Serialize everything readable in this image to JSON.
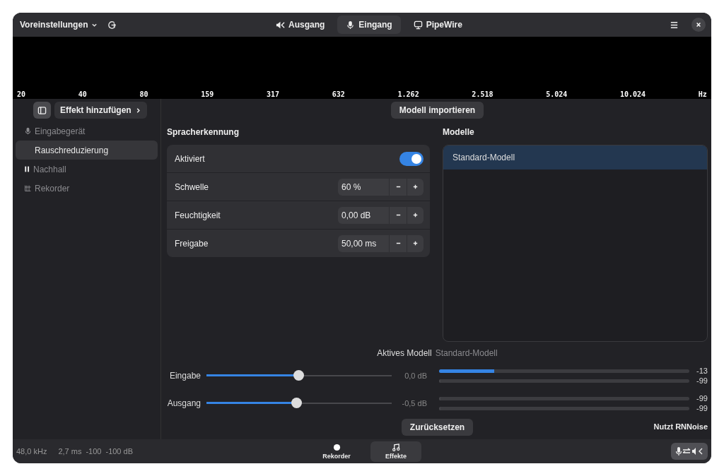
{
  "header": {
    "presets": {
      "label": "Voreinstellungen"
    },
    "tabs": [
      {
        "label": "Ausgang",
        "kind": "output",
        "selected": false
      },
      {
        "label": "Eingang",
        "kind": "input",
        "selected": true
      },
      {
        "label": "PipeWire",
        "kind": "pipewire",
        "selected": false
      }
    ]
  },
  "spectrum": {
    "labels": [
      "20",
      "40",
      "80",
      "159",
      "317",
      "632",
      "1.262",
      "2.518",
      "5.024",
      "10.024",
      "Hz"
    ]
  },
  "sidebar": {
    "add_button": "Effekt hinzufügen",
    "items": [
      {
        "label": "Eingabegerät",
        "kind": "device",
        "selected": false
      },
      {
        "label": "Rauschreduzierung",
        "kind": "plugin",
        "selected": true
      },
      {
        "label": "Nachhall",
        "kind": "paused",
        "selected": false
      },
      {
        "label": "Rekorder",
        "kind": "recorder",
        "selected": false
      }
    ]
  },
  "main": {
    "import_button": "Modell importieren",
    "voice": {
      "title": "Spracherkennung",
      "rows": [
        {
          "label": "Aktiviert",
          "kind": "switch",
          "on": true
        },
        {
          "label": "Schwelle",
          "kind": "spin",
          "value": "60 %"
        },
        {
          "label": "Feuchtigkeit",
          "kind": "spin",
          "value": "0,00 dB"
        },
        {
          "label": "Freigabe",
          "kind": "spin",
          "value": "50,00 ms"
        }
      ]
    },
    "models": {
      "title": "Modelle",
      "items": [
        {
          "label": "Standard-Modell",
          "selected": true
        }
      ]
    },
    "active_model": {
      "label": "Aktives Modell",
      "value": "Standard-Modell"
    },
    "gains": [
      {
        "label": "Eingabe",
        "level": 0.5,
        "reading": "0,0 dB",
        "meters": [
          {
            "level": 0.22,
            "reading": "-13"
          },
          {
            "level": 0,
            "reading": "-99"
          }
        ]
      },
      {
        "label": "Ausgang",
        "level": 0.49,
        "reading": "-0,5 dB",
        "meters": [
          {
            "level": 0,
            "reading": "-99"
          },
          {
            "level": 0,
            "reading": "-99"
          }
        ]
      }
    ],
    "reset_button": "Zurücksetzen",
    "engine_note": "Nutzt RNNoise"
  },
  "status_bar": {
    "readings": [
      "48,0 kHz",
      "2,7 ms",
      "-100",
      "-100 dB"
    ],
    "tabs": [
      {
        "label": "Rekorder",
        "kind": "recorder",
        "selected": false
      },
      {
        "label": "Effekte",
        "kind": "effects",
        "selected": true
      }
    ]
  }
}
